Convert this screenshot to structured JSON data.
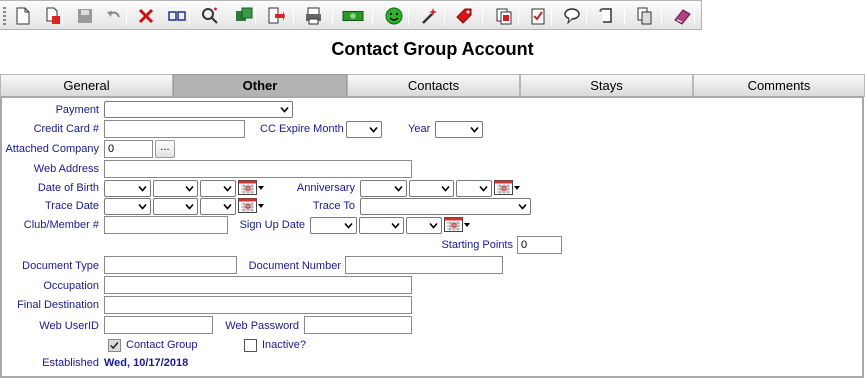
{
  "toolbar": {
    "buttons": [
      {
        "name": "new-document-icon",
        "color": "#333333"
      },
      {
        "name": "copy-document-icon",
        "color": "#cc2222"
      },
      {
        "name": "save-icon",
        "color": "#888888"
      },
      {
        "name": "undo-icon",
        "color": "#888888"
      },
      {
        "name": "delete-icon",
        "color": "#cc1111"
      },
      {
        "name": "merge-icon",
        "color": "#223388"
      },
      {
        "name": "search-icon",
        "color": "#aa2222"
      },
      {
        "name": "tasks-icon",
        "color": "#227733"
      },
      {
        "name": "export-icon",
        "color": "#cc2222"
      },
      {
        "name": "print-icon",
        "color": "#333333"
      },
      {
        "name": "money-icon",
        "color": "#22aa22"
      },
      {
        "name": "smiley-icon",
        "color": "#22aa22"
      },
      {
        "name": "wand-icon",
        "color": "#aa2222"
      },
      {
        "name": "tag-icon",
        "color": "#cc1111"
      },
      {
        "name": "documents-icon",
        "color": "#aa2222"
      },
      {
        "name": "checklist-icon",
        "color": "#aa2222"
      },
      {
        "name": "speech-bubble-icon",
        "color": "#333333"
      },
      {
        "name": "scroll-icon",
        "color": "#333333"
      },
      {
        "name": "copy-pages-icon",
        "color": "#333333"
      },
      {
        "name": "book-icon",
        "color": "#aa2266"
      }
    ]
  },
  "title": "Contact Group Account",
  "tabs": [
    {
      "label": "General"
    },
    {
      "label": "Other"
    },
    {
      "label": "Contacts"
    },
    {
      "label": "Stays"
    },
    {
      "label": "Comments"
    }
  ],
  "active_tab": "Other",
  "form": {
    "payment": {
      "label": "Payment",
      "value": ""
    },
    "credit_card": {
      "label": "Credit Card #",
      "value": ""
    },
    "cc_expire_month": {
      "label": "CC Expire Month",
      "value": ""
    },
    "year": {
      "label": "Year",
      "value": ""
    },
    "attached_company": {
      "label": "Attached Company",
      "value": "0",
      "browse": "..."
    },
    "web_address": {
      "label": "Web Address",
      "value": ""
    },
    "date_of_birth": {
      "label": "Date of Birth"
    },
    "anniversary": {
      "label": "Anniversary"
    },
    "trace_date": {
      "label": "Trace Date"
    },
    "trace_to": {
      "label": "Trace To",
      "value": ""
    },
    "club_member": {
      "label": "Club/Member #",
      "value": ""
    },
    "sign_up_date": {
      "label": "Sign Up Date"
    },
    "starting_points": {
      "label": "Starting Points",
      "value": "0"
    },
    "document_type": {
      "label": "Document Type",
      "value": ""
    },
    "document_number": {
      "label": "Document Number",
      "value": ""
    },
    "occupation": {
      "label": "Occupation",
      "value": ""
    },
    "final_destination": {
      "label": "Final Destination",
      "value": ""
    },
    "web_userid": {
      "label": "Web UserID",
      "value": ""
    },
    "web_password": {
      "label": "Web Password",
      "value": ""
    },
    "contact_group": {
      "label": "Contact Group",
      "checked": true
    },
    "inactive": {
      "label": "Inactive?",
      "checked": false
    },
    "established": {
      "label": "Established",
      "value": "Wed, 10/17/2018"
    }
  }
}
